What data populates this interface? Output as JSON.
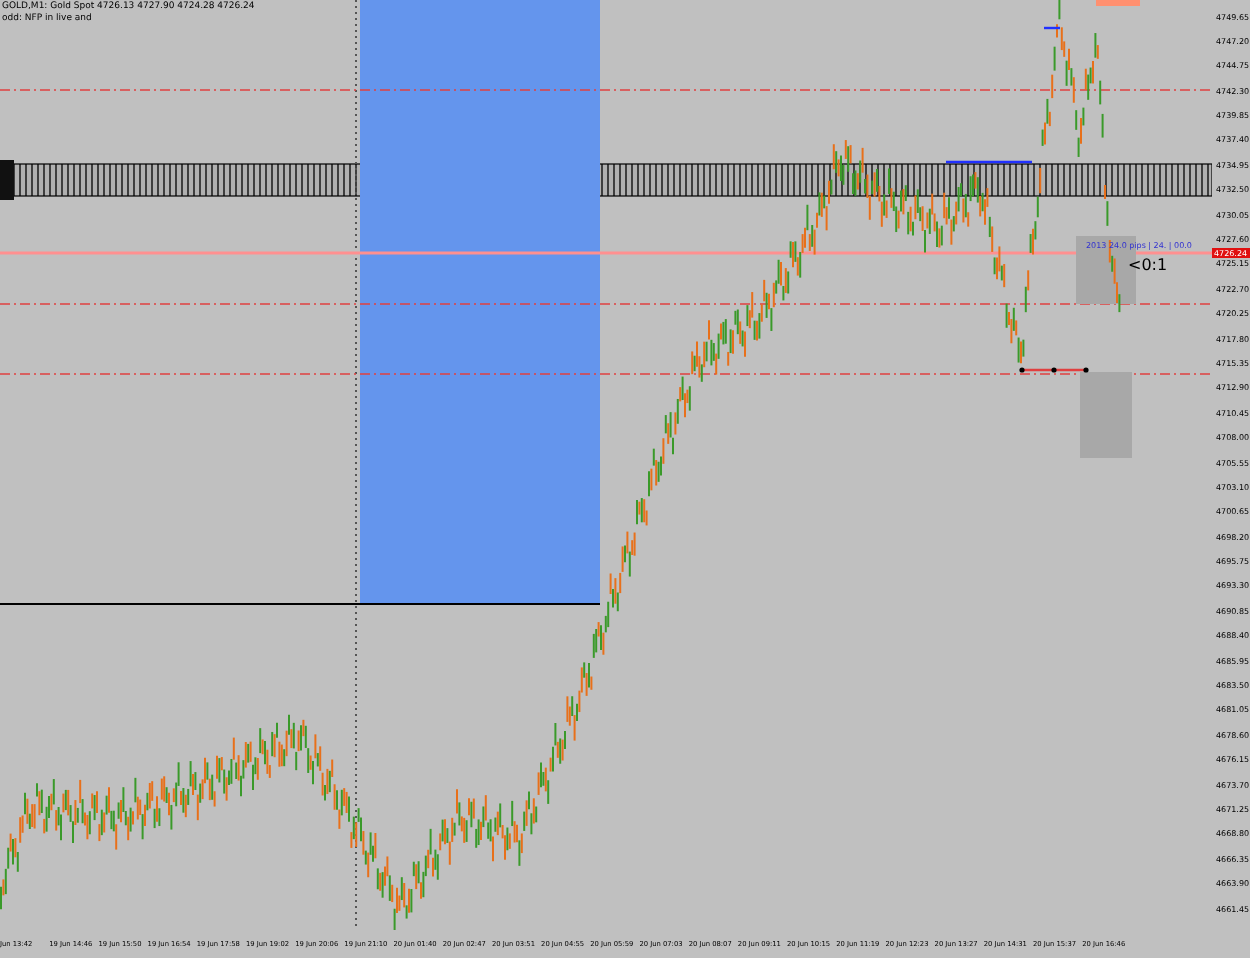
{
  "header": {
    "title_line": "GOLD,M1: Gold Spot 4726.13 4727.90 4724.28 4726.24",
    "note": "odd: NFP in live and"
  },
  "chart": {
    "trade_label": "2013 24.0 pips | 24. | 00.0",
    "ratio_label": "<0:1",
    "price_label": "4726.24"
  },
  "price_axis": [
    "4749.65",
    "4747.20",
    "4744.75",
    "4742.30",
    "4739.85",
    "4737.40",
    "4734.95",
    "4732.50",
    "4730.05",
    "4727.60",
    "4725.15",
    "4722.70",
    "4720.25",
    "4717.80",
    "4715.35",
    "4712.90",
    "4710.45",
    "4708.00",
    "4705.55",
    "4703.10",
    "4700.65",
    "4698.20",
    "4695.75",
    "4693.30",
    "4690.85",
    "4688.40",
    "4685.95",
    "4683.50",
    "4681.05",
    "4678.60",
    "4676.15",
    "4673.70",
    "4671.25",
    "4668.80",
    "4666.35",
    "4663.90",
    "4661.45"
  ],
  "time_axis": [
    "Jun 13:42",
    "19 Jun 14:46",
    "19 Jun 15:50",
    "19 Jun 16:54",
    "19 Jun 17:58",
    "19 Jun 19:02",
    "19 Jun 20:06",
    "19 Jun 21:10",
    "20 Jun 01:40",
    "20 Jun 02:47",
    "20 Jun 03:51",
    "20 Jun 04:55",
    "20 Jun 05:59",
    "20 Jun 07:03",
    "20 Jun 08:07",
    "20 Jun 09:11",
    "20 Jun 10:15",
    "20 Jun 11:19",
    "20 Jun 12:23",
    "20 Jun 13:27",
    "20 Jun 14:31",
    "20 Jun 15:37",
    "20 Jun 16:46"
  ]
}
